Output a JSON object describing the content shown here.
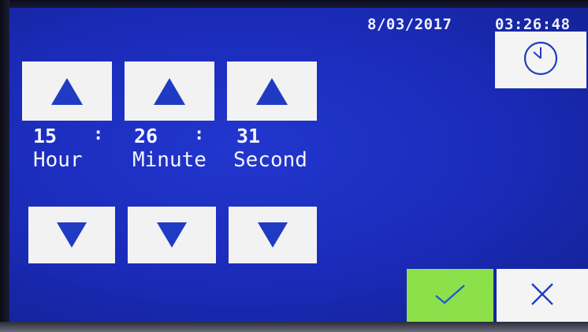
{
  "header": {
    "date": "8/03/2017",
    "time": "03:26:48"
  },
  "clock_button": {
    "icon": "clock-icon"
  },
  "setter": {
    "hour": {
      "value": "15",
      "label": "Hour"
    },
    "minute": {
      "value": "26",
      "label": "Minute"
    },
    "second": {
      "value": "31",
      "label": "Second"
    },
    "separator": ":"
  },
  "actions": {
    "confirm_icon": "checkmark-icon",
    "cancel_icon": "close-icon"
  },
  "colors": {
    "screen_background": "#1a2bb8",
    "button_background": "#f2f2f2",
    "arrow": "#1f3bc4",
    "confirm": "#8ce04a",
    "text": "#f3f4ff"
  }
}
